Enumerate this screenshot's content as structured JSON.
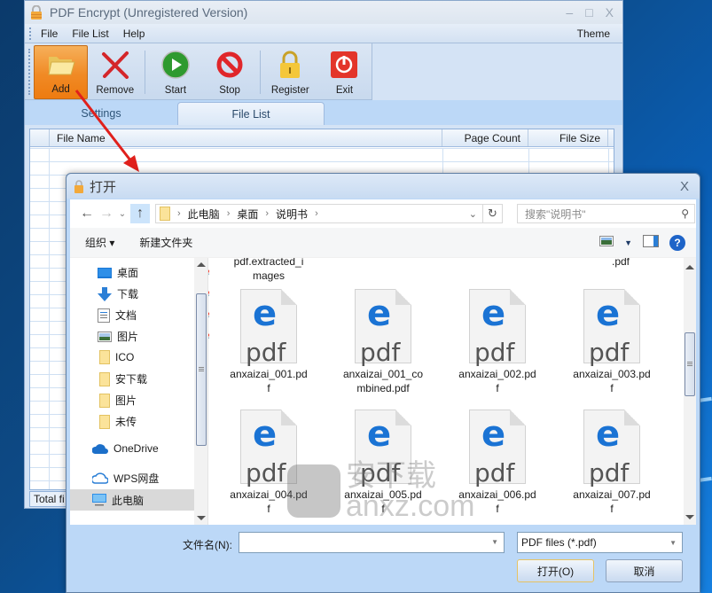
{
  "main_window": {
    "title": "PDF Encrypt (Unregistered Version)",
    "window_controls": {
      "minimize": "–",
      "maximize": "□",
      "close": "X"
    },
    "menu": [
      {
        "label": "File"
      },
      {
        "label": "File List"
      },
      {
        "label": "Help"
      }
    ],
    "theme_menu": "Theme",
    "toolbar": [
      {
        "label": "Add",
        "icon": "folder-open-icon",
        "active": true
      },
      {
        "label": "Remove",
        "icon": "red-x-icon"
      },
      {
        "label": "Start",
        "icon": "play-icon"
      },
      {
        "label": "Stop",
        "icon": "stop-icon"
      },
      {
        "label": "Register",
        "icon": "padlock-icon"
      },
      {
        "label": "Exit",
        "icon": "power-icon"
      }
    ],
    "tabs": [
      {
        "label": "Settings",
        "active": false
      },
      {
        "label": "File List",
        "active": true
      }
    ],
    "grid": {
      "columns": [
        "File Name",
        "Page Count",
        "File Size"
      ]
    },
    "status_text": "Total fi"
  },
  "dialog": {
    "title": "打开",
    "close": "X",
    "breadcrumb": [
      "此电脑",
      "桌面",
      "说明书"
    ],
    "search_placeholder": "搜索\"说明书\"",
    "organize_label": "组织 ▾",
    "new_folder_label": "新建文件夹",
    "nav_items": [
      {
        "label": "桌面",
        "icon": "desktop-icon",
        "pinned": true
      },
      {
        "label": "下载",
        "icon": "download-arrow-icon",
        "pinned": true
      },
      {
        "label": "文档",
        "icon": "document-icon",
        "pinned": true
      },
      {
        "label": "图片",
        "icon": "pictures-icon",
        "pinned": true
      },
      {
        "label": "ICO",
        "icon": "folder-icon",
        "pinned": false
      },
      {
        "label": "安下载",
        "icon": "folder-icon",
        "pinned": false
      },
      {
        "label": "图片",
        "icon": "folder-icon",
        "pinned": false
      },
      {
        "label": "未传",
        "icon": "folder-icon",
        "pinned": false
      },
      {
        "label": "OneDrive",
        "icon": "onedrive-cloud-icon",
        "pinned": false
      },
      {
        "label": "WPS网盘",
        "icon": "wps-cloud-icon",
        "pinned": false
      },
      {
        "label": "此电脑",
        "icon": "computer-icon",
        "pinned": false,
        "selected": true
      }
    ],
    "partial_items": [
      {
        "label": "pdf.extracted_i\nmages"
      },
      {
        "label": ".pdf"
      }
    ],
    "files": [
      {
        "name_line1": "anxaizai_001.pd",
        "name_line2": "f"
      },
      {
        "name_line1": "anxaizai_001_co",
        "name_line2": "mbined.pdf"
      },
      {
        "name_line1": "anxaizai_002.pd",
        "name_line2": "f"
      },
      {
        "name_line1": "anxaizai_003.pd",
        "name_line2": "f"
      },
      {
        "name_line1": "anxaizai_004.pd",
        "name_line2": "f"
      },
      {
        "name_line1": "anxaizai_005.pd",
        "name_line2": "f"
      },
      {
        "name_line1": "anxaizai_006.pd",
        "name_line2": "f"
      },
      {
        "name_line1": "anxaizai_007.pd",
        "name_line2": "f"
      }
    ],
    "file_icon_label": "pdf",
    "watermark": {
      "cn": "安下载",
      "en": "anxz.com"
    },
    "filename_label": "文件名(N):",
    "filename_value": "",
    "filetype_selected": "PDF files (*.pdf)",
    "open_button": "打开(O)",
    "cancel_button": "取消"
  }
}
